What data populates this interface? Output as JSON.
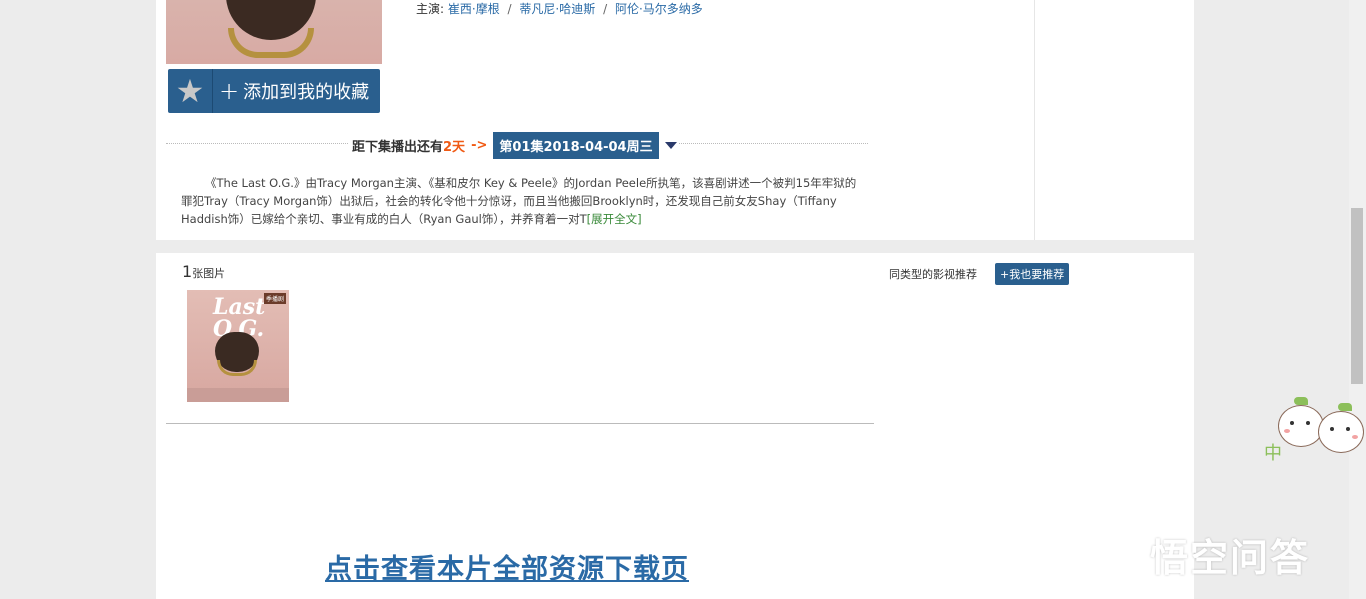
{
  "movie": {
    "actors_label": "主演:",
    "actors": [
      "崔西·摩根",
      "蒂凡尼·哈迪斯",
      "阿伦·马尔多纳多"
    ],
    "actor_sep": "/"
  },
  "favorite": {
    "label": "添加到我的收藏",
    "plus": "+"
  },
  "next_episode": {
    "label": "距下集播出还有",
    "days": "2天",
    "arrow": "->",
    "episode": "第01集2018-04-04周三"
  },
  "synopsis": {
    "text": "《The Last O.G.》由Tracy Morgan主演、《基和皮尔 Key & Peele》的Jordan Peele所执笔，该喜剧讲述一个被判15年牢狱的罪犯Tray（Tracy Morgan饰）出狱后，社会的转化令他十分惊讶，而且当他搬回Brooklyn时，还发现自己前女友Shay（Tiffany Haddish饰）已嫁给个亲切、事业有成的白人（Ryan Gaul饰），并养育着一对T",
    "more": "[展开全文]"
  },
  "photos": {
    "count": "1",
    "label": "张图片"
  },
  "thumbnail": {
    "title": "Last O.G.",
    "badge": "季播剧"
  },
  "download": {
    "label": "点击查看本片全部资源下载页"
  },
  "recommend": {
    "label": "同类型的影视推荐",
    "button": "+我也要推荐"
  },
  "mascot": {
    "text": "中"
  },
  "watermark": {
    "text": "悟空问答"
  },
  "colors": {
    "accent": "#2a5f8e",
    "link": "#2a6aa6",
    "highlight": "#f05a14",
    "more_link": "#3a8a3a"
  }
}
